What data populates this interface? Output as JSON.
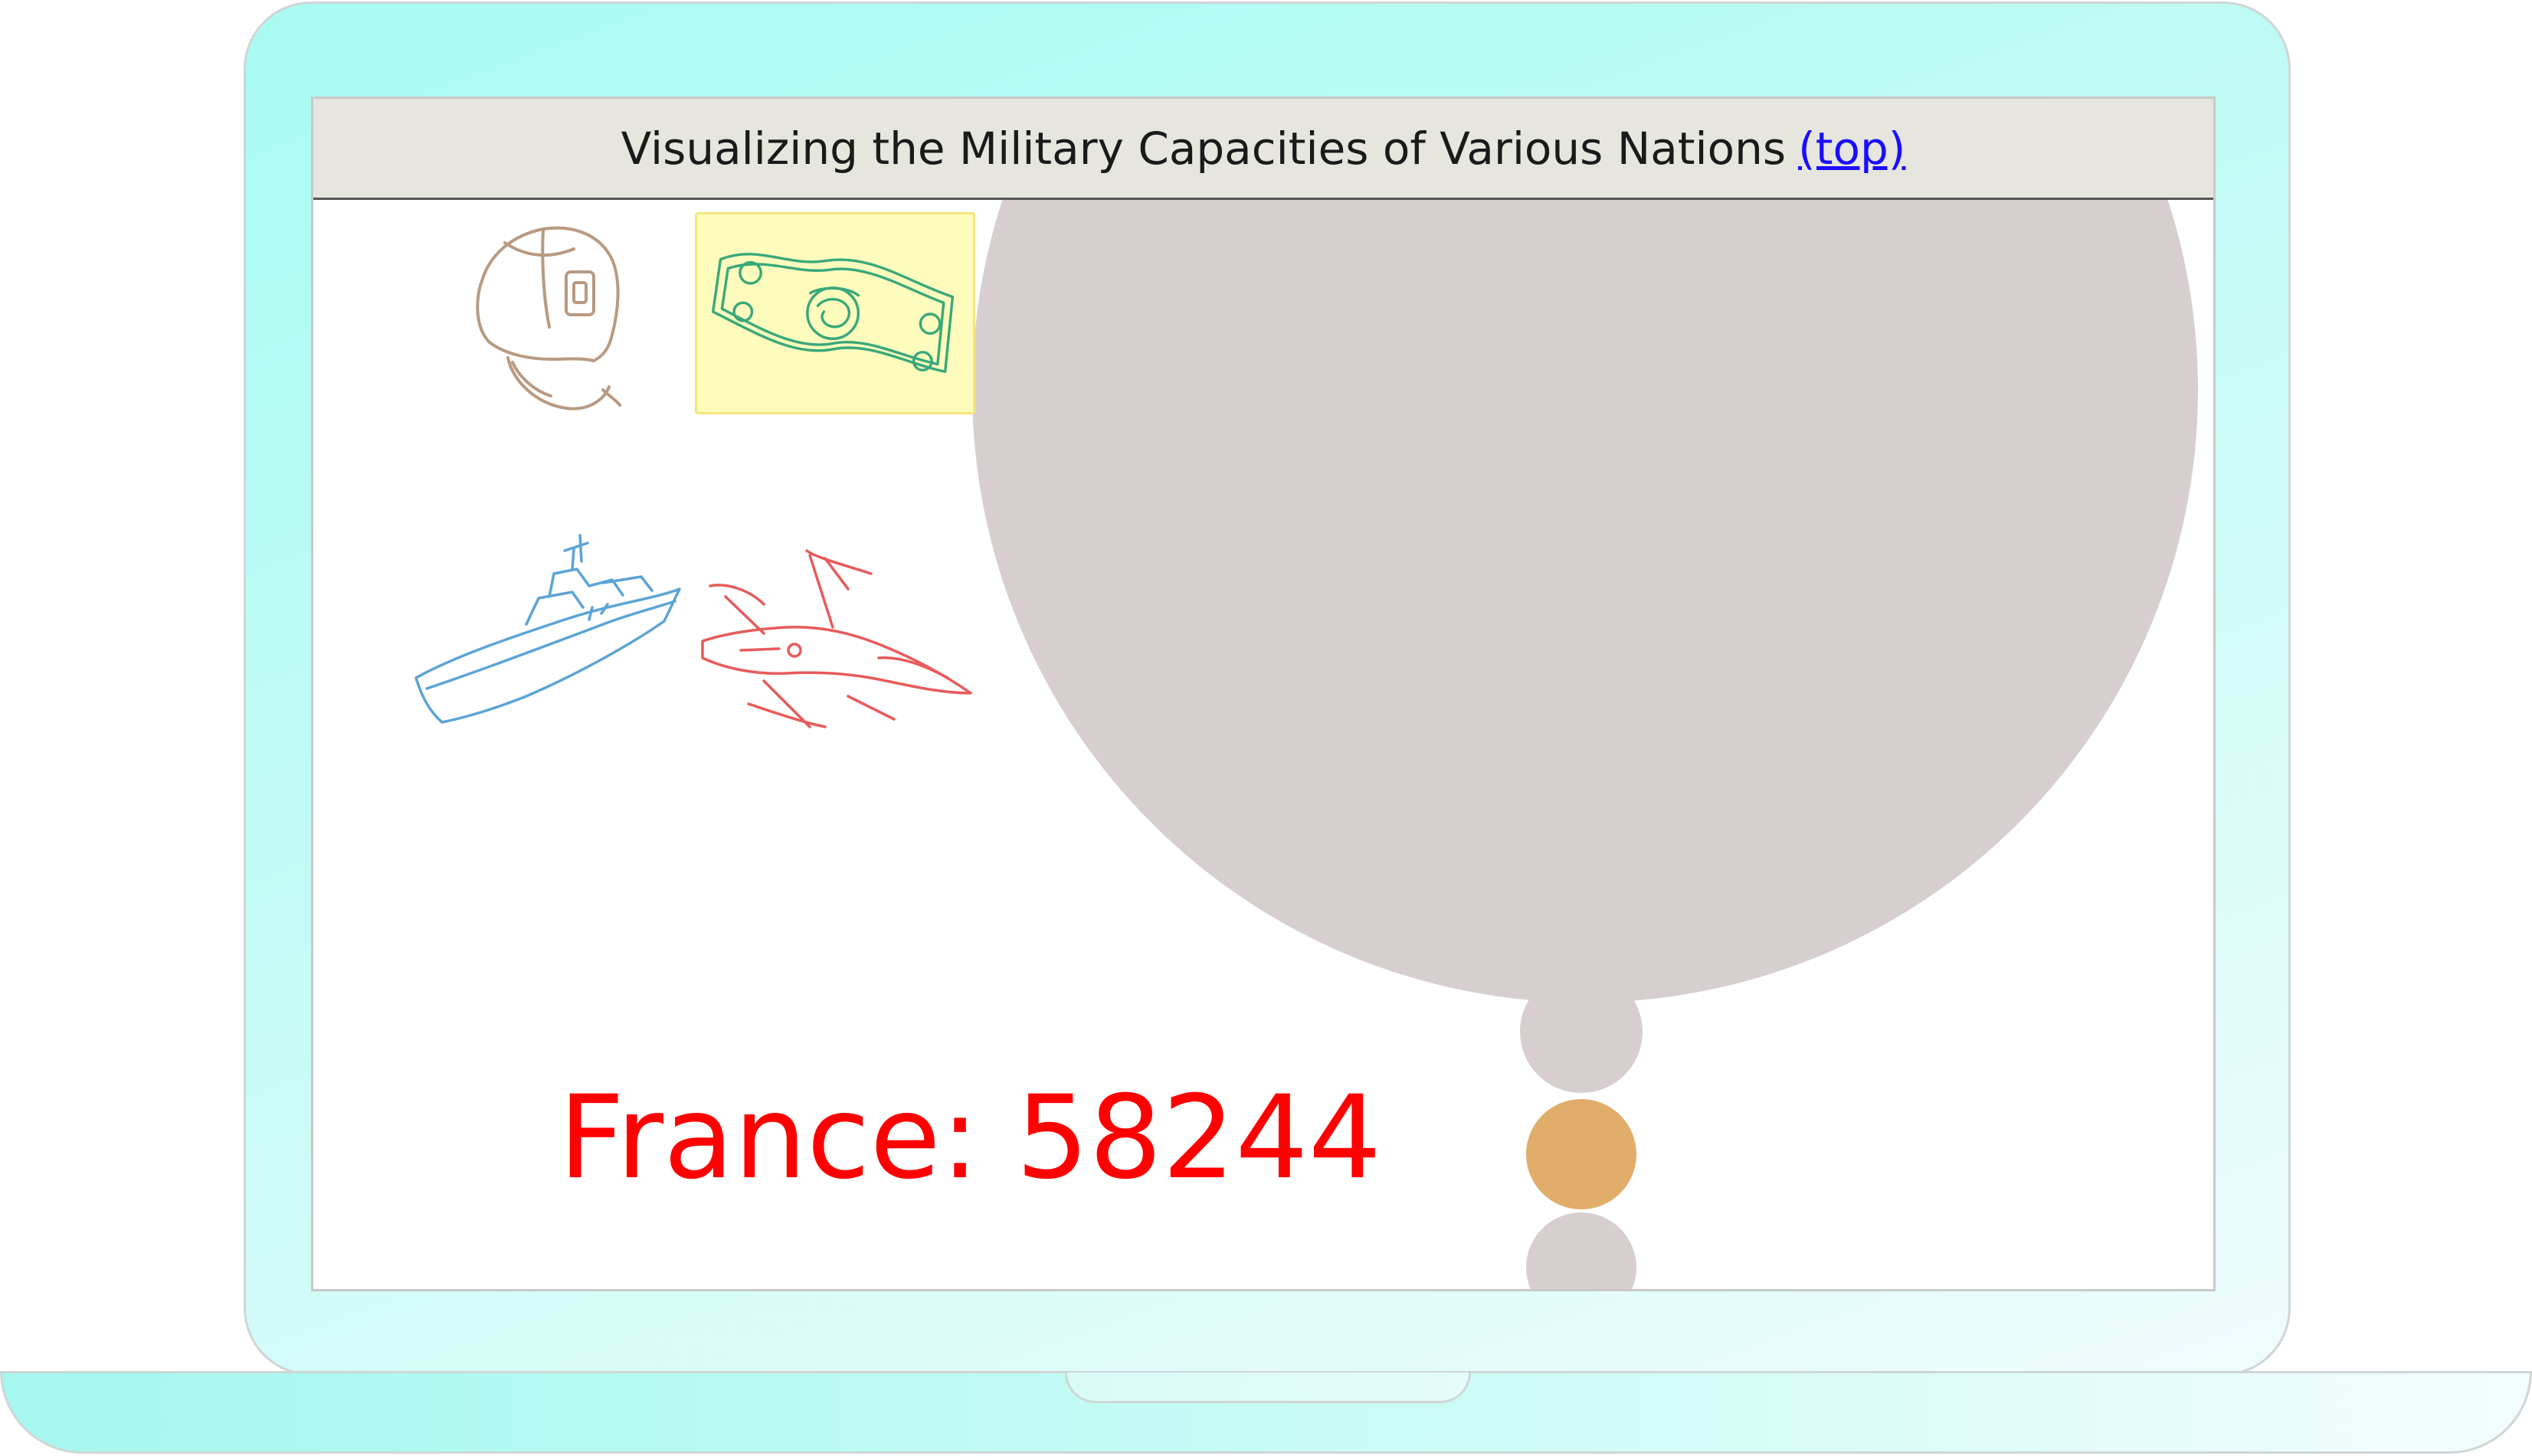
{
  "header": {
    "title": "Visualizing the Military Capacities of Various Nations",
    "top_link": "(top)"
  },
  "icons": [
    {
      "name": "soldier-helmet",
      "color": "#b89a82",
      "selected": false
    },
    {
      "name": "money-bill",
      "color": "#3aa87a",
      "selected": true
    },
    {
      "name": "warship",
      "color": "#5ba4d6",
      "selected": false
    },
    {
      "name": "fighter-jet",
      "color": "#e85a5a",
      "selected": false
    }
  ],
  "readout": {
    "country": "France",
    "separator": ": ",
    "value": "58244",
    "color": "#ff0000"
  },
  "bubbles": [
    {
      "name": "country-bubble-large",
      "color": "#d7cfcf",
      "highlighted": false
    },
    {
      "name": "country-bubble-medium",
      "color": "#d7cfcf",
      "highlighted": false
    },
    {
      "name": "country-bubble-small",
      "color": "#d7cfcf",
      "highlighted": false
    },
    {
      "name": "country-bubble-france",
      "color": "#e1ad6a",
      "highlighted": true
    },
    {
      "name": "country-bubble-bottom",
      "color": "#d7cfcf",
      "highlighted": false
    }
  ]
}
